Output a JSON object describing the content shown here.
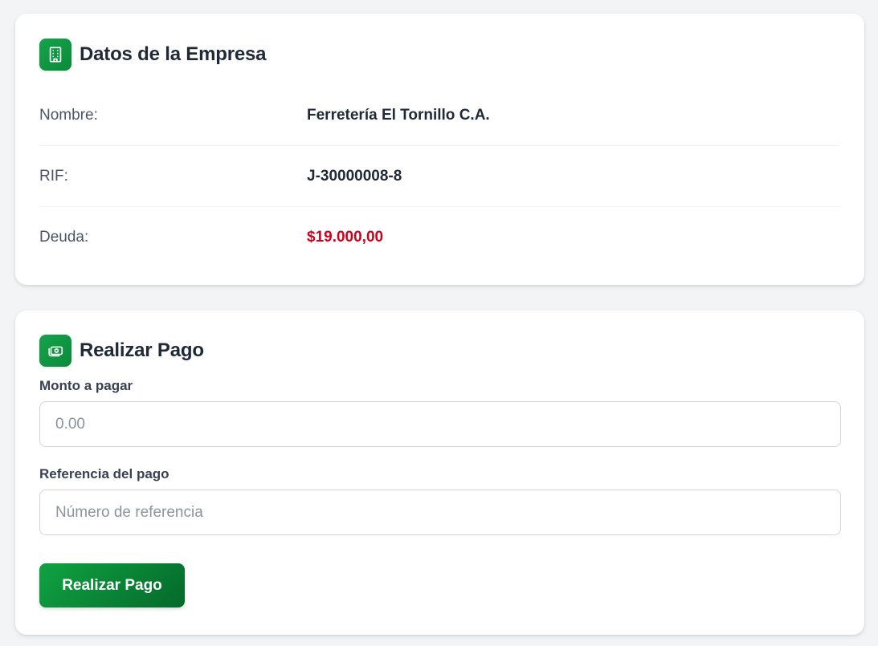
{
  "company_card": {
    "icon": "building-icon",
    "title": "Datos de la Empresa",
    "rows": [
      {
        "label": "Nombre:",
        "value": "Ferretería El Tornillo C.A."
      },
      {
        "label": "RIF:",
        "value": "J-30000008-8"
      },
      {
        "label": "Deuda:",
        "value": "$19.000,00"
      }
    ]
  },
  "payment_card": {
    "icon": "cash-icon",
    "title": "Realizar Pago",
    "amount_label": "Monto a pagar",
    "amount_value": "",
    "amount_placeholder": "0.00",
    "reference_label": "Referencia del pago",
    "reference_value": "",
    "reference_placeholder": "Número de referencia",
    "submit_label": "Realizar Pago"
  },
  "colors": {
    "accent_green": "#16a34a",
    "debt_red": "#d0021b",
    "background": "#f3f4f6"
  }
}
